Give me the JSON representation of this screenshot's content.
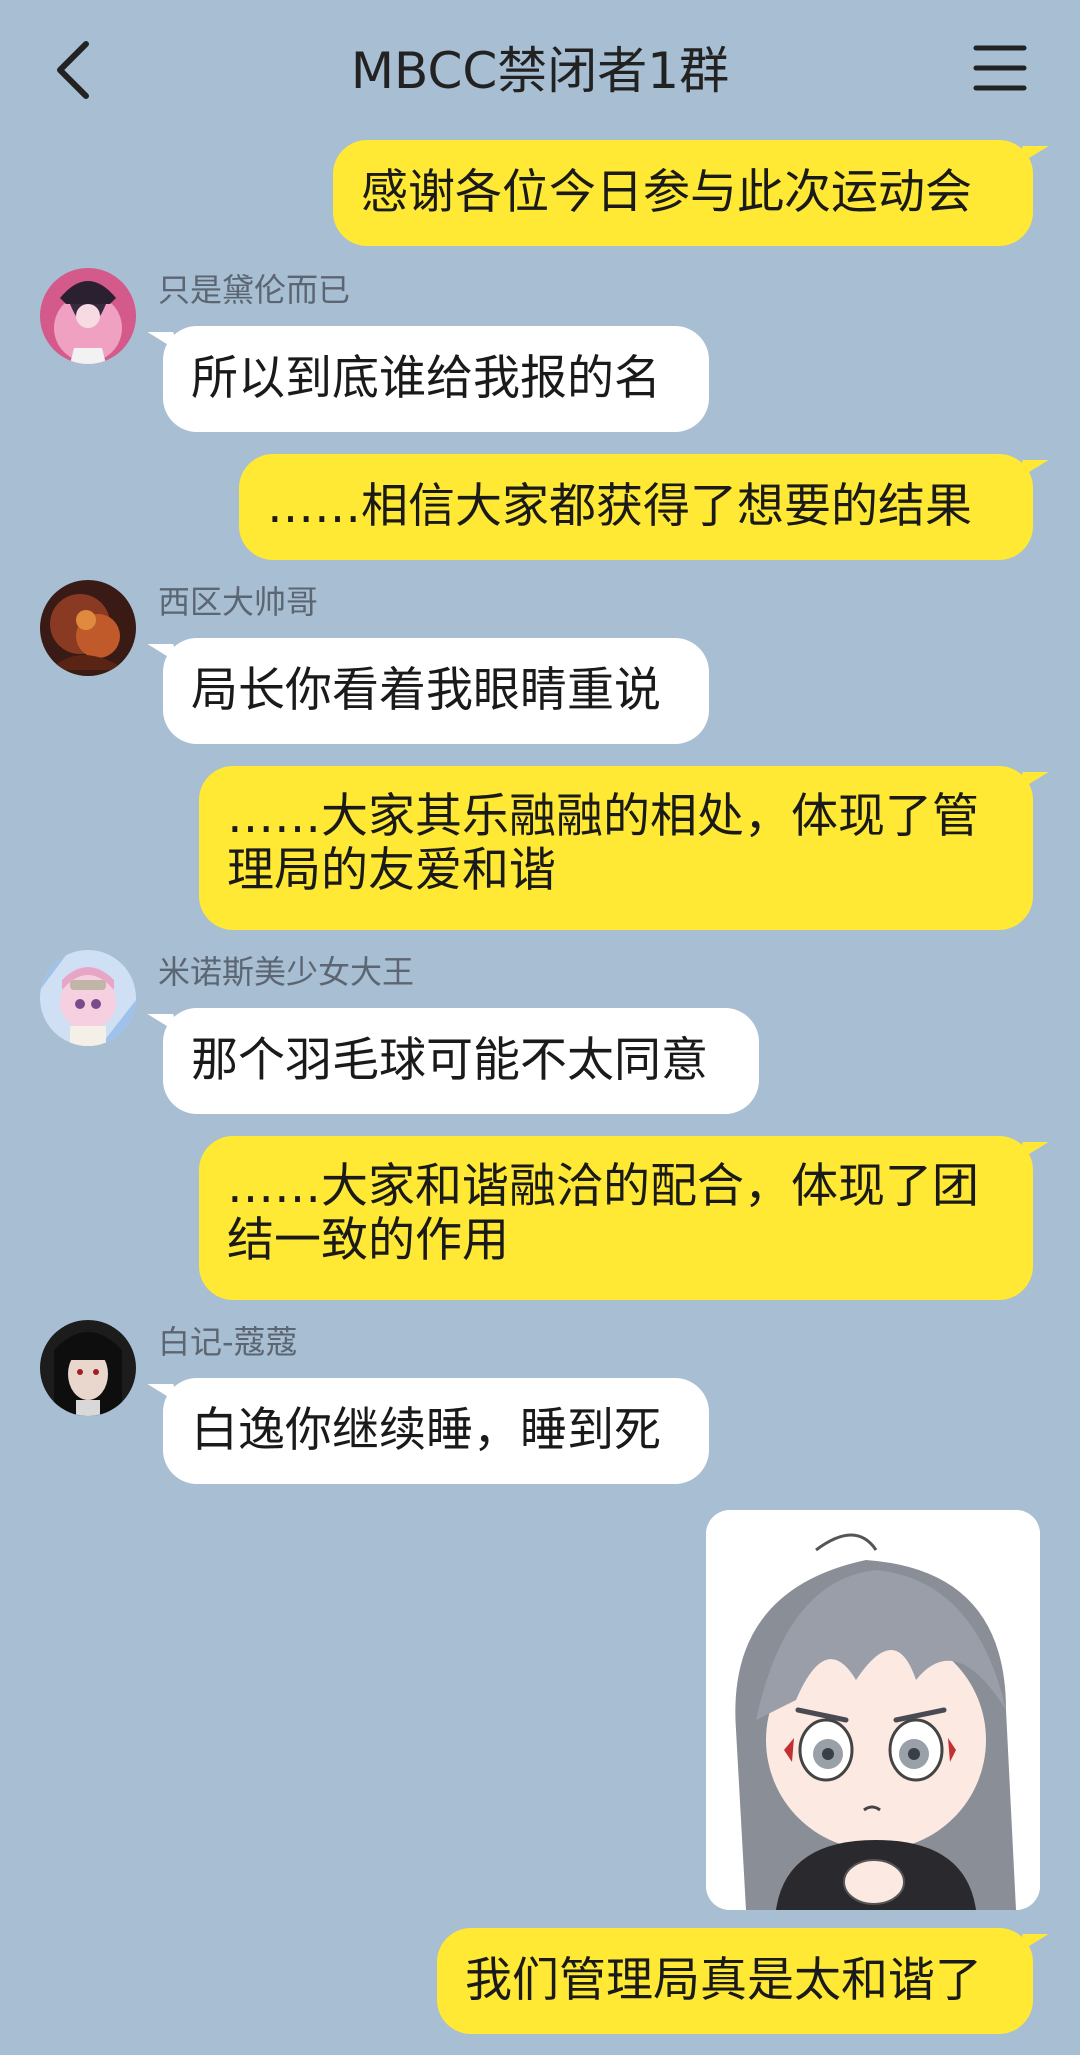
{
  "header": {
    "title": "MBCC禁闭者1群",
    "back_icon": "chevron-left-icon",
    "menu_icon": "hamburger-menu-icon"
  },
  "messages": [
    {
      "type": "outgoing",
      "text": "感谢各位今日参与此次运动会"
    },
    {
      "type": "incoming",
      "sender": "只是黛伦而已",
      "text": "所以到底谁给我报的名"
    },
    {
      "type": "outgoing",
      "text": "……相信大家都获得了想要的结果"
    },
    {
      "type": "incoming",
      "sender": "西区大帅哥",
      "text": "局长你看着我眼睛重说"
    },
    {
      "type": "outgoing",
      "text": "……大家其乐融融的相处，体现了管理局的友爱和谐"
    },
    {
      "type": "incoming",
      "sender": "米诺斯美少女大王",
      "text": "那个羽毛球可能不太同意"
    },
    {
      "type": "outgoing",
      "text": "……大家和谐融洽的配合，体现了团结一致的作用"
    },
    {
      "type": "incoming",
      "sender": "白记-蔻蔻",
      "text": "白逸你继续睡，睡到死"
    },
    {
      "type": "sticker",
      "description": "chibi-character-sticker"
    },
    {
      "type": "outgoing",
      "text": "我们管理局真是太和谐了"
    }
  ],
  "colors": {
    "background": "#a8bed2",
    "outgoing_bubble": "#ffe934",
    "incoming_bubble": "#ffffff"
  }
}
